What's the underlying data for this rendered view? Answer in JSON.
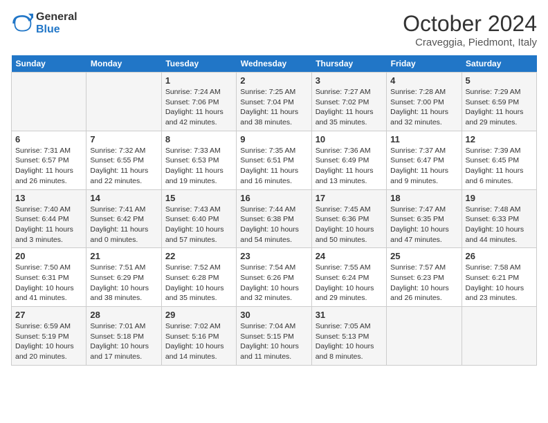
{
  "logo": {
    "line1": "General",
    "line2": "Blue"
  },
  "title": "October 2024",
  "location": "Craveggia, Piedmont, Italy",
  "weekdays": [
    "Sunday",
    "Monday",
    "Tuesday",
    "Wednesday",
    "Thursday",
    "Friday",
    "Saturday"
  ],
  "weeks": [
    [
      {
        "day": "",
        "info": ""
      },
      {
        "day": "",
        "info": ""
      },
      {
        "day": "1",
        "info": "Sunrise: 7:24 AM\nSunset: 7:06 PM\nDaylight: 11 hours and 42 minutes."
      },
      {
        "day": "2",
        "info": "Sunrise: 7:25 AM\nSunset: 7:04 PM\nDaylight: 11 hours and 38 minutes."
      },
      {
        "day": "3",
        "info": "Sunrise: 7:27 AM\nSunset: 7:02 PM\nDaylight: 11 hours and 35 minutes."
      },
      {
        "day": "4",
        "info": "Sunrise: 7:28 AM\nSunset: 7:00 PM\nDaylight: 11 hours and 32 minutes."
      },
      {
        "day": "5",
        "info": "Sunrise: 7:29 AM\nSunset: 6:59 PM\nDaylight: 11 hours and 29 minutes."
      }
    ],
    [
      {
        "day": "6",
        "info": "Sunrise: 7:31 AM\nSunset: 6:57 PM\nDaylight: 11 hours and 26 minutes."
      },
      {
        "day": "7",
        "info": "Sunrise: 7:32 AM\nSunset: 6:55 PM\nDaylight: 11 hours and 22 minutes."
      },
      {
        "day": "8",
        "info": "Sunrise: 7:33 AM\nSunset: 6:53 PM\nDaylight: 11 hours and 19 minutes."
      },
      {
        "day": "9",
        "info": "Sunrise: 7:35 AM\nSunset: 6:51 PM\nDaylight: 11 hours and 16 minutes."
      },
      {
        "day": "10",
        "info": "Sunrise: 7:36 AM\nSunset: 6:49 PM\nDaylight: 11 hours and 13 minutes."
      },
      {
        "day": "11",
        "info": "Sunrise: 7:37 AM\nSunset: 6:47 PM\nDaylight: 11 hours and 9 minutes."
      },
      {
        "day": "12",
        "info": "Sunrise: 7:39 AM\nSunset: 6:45 PM\nDaylight: 11 hours and 6 minutes."
      }
    ],
    [
      {
        "day": "13",
        "info": "Sunrise: 7:40 AM\nSunset: 6:44 PM\nDaylight: 11 hours and 3 minutes."
      },
      {
        "day": "14",
        "info": "Sunrise: 7:41 AM\nSunset: 6:42 PM\nDaylight: 11 hours and 0 minutes."
      },
      {
        "day": "15",
        "info": "Sunrise: 7:43 AM\nSunset: 6:40 PM\nDaylight: 10 hours and 57 minutes."
      },
      {
        "day": "16",
        "info": "Sunrise: 7:44 AM\nSunset: 6:38 PM\nDaylight: 10 hours and 54 minutes."
      },
      {
        "day": "17",
        "info": "Sunrise: 7:45 AM\nSunset: 6:36 PM\nDaylight: 10 hours and 50 minutes."
      },
      {
        "day": "18",
        "info": "Sunrise: 7:47 AM\nSunset: 6:35 PM\nDaylight: 10 hours and 47 minutes."
      },
      {
        "day": "19",
        "info": "Sunrise: 7:48 AM\nSunset: 6:33 PM\nDaylight: 10 hours and 44 minutes."
      }
    ],
    [
      {
        "day": "20",
        "info": "Sunrise: 7:50 AM\nSunset: 6:31 PM\nDaylight: 10 hours and 41 minutes."
      },
      {
        "day": "21",
        "info": "Sunrise: 7:51 AM\nSunset: 6:29 PM\nDaylight: 10 hours and 38 minutes."
      },
      {
        "day": "22",
        "info": "Sunrise: 7:52 AM\nSunset: 6:28 PM\nDaylight: 10 hours and 35 minutes."
      },
      {
        "day": "23",
        "info": "Sunrise: 7:54 AM\nSunset: 6:26 PM\nDaylight: 10 hours and 32 minutes."
      },
      {
        "day": "24",
        "info": "Sunrise: 7:55 AM\nSunset: 6:24 PM\nDaylight: 10 hours and 29 minutes."
      },
      {
        "day": "25",
        "info": "Sunrise: 7:57 AM\nSunset: 6:23 PM\nDaylight: 10 hours and 26 minutes."
      },
      {
        "day": "26",
        "info": "Sunrise: 7:58 AM\nSunset: 6:21 PM\nDaylight: 10 hours and 23 minutes."
      }
    ],
    [
      {
        "day": "27",
        "info": "Sunrise: 6:59 AM\nSunset: 5:19 PM\nDaylight: 10 hours and 20 minutes."
      },
      {
        "day": "28",
        "info": "Sunrise: 7:01 AM\nSunset: 5:18 PM\nDaylight: 10 hours and 17 minutes."
      },
      {
        "day": "29",
        "info": "Sunrise: 7:02 AM\nSunset: 5:16 PM\nDaylight: 10 hours and 14 minutes."
      },
      {
        "day": "30",
        "info": "Sunrise: 7:04 AM\nSunset: 5:15 PM\nDaylight: 10 hours and 11 minutes."
      },
      {
        "day": "31",
        "info": "Sunrise: 7:05 AM\nSunset: 5:13 PM\nDaylight: 10 hours and 8 minutes."
      },
      {
        "day": "",
        "info": ""
      },
      {
        "day": "",
        "info": ""
      }
    ]
  ]
}
